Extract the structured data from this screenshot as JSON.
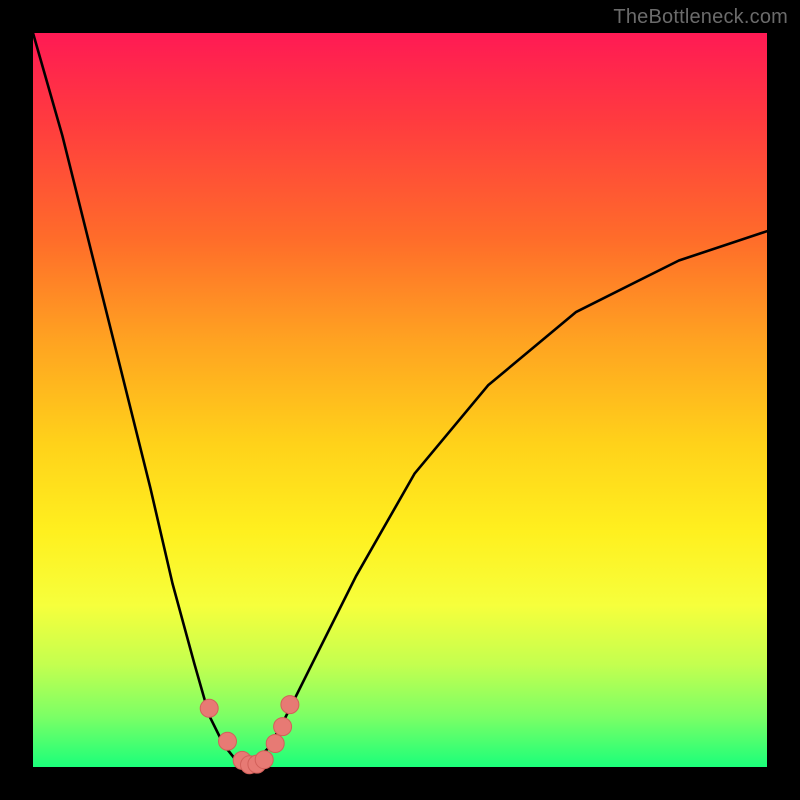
{
  "watermark": "TheBottleneck.com",
  "colors": {
    "frame": "#000000",
    "curve": "#000000",
    "marker_fill": "#e77a74",
    "marker_stroke": "#d2605a",
    "gradient_top": "#ff1a54",
    "gradient_bottom": "#1bff7a"
  },
  "chart_data": {
    "type": "line",
    "title": "",
    "xlabel": "",
    "ylabel": "",
    "xlim": [
      0,
      100
    ],
    "ylim": [
      0,
      100
    ],
    "notes": "y-axis inverted visually: 0 (best/green) at bottom, 100 (worst/red) at top. Curve represents bottleneck percentage vs. component scaling; minimum at x≈29 where bottleneck ≈0.",
    "series": [
      {
        "name": "bottleneck-curve",
        "x": [
          0,
          4,
          8,
          12,
          16,
          19,
          22,
          24,
          26,
          28,
          29,
          30,
          32,
          34,
          38,
          44,
          52,
          62,
          74,
          88,
          100
        ],
        "values": [
          100,
          86,
          70,
          54,
          38,
          25,
          14,
          7,
          3,
          0.5,
          0,
          0.5,
          2.5,
          6,
          14,
          26,
          40,
          52,
          62,
          69,
          73
        ]
      }
    ],
    "markers": {
      "name": "highlight-points",
      "x": [
        24,
        26.5,
        28.5,
        29.5,
        30.5,
        31.5,
        33,
        34,
        35
      ],
      "values": [
        8,
        3.5,
        0.9,
        0.3,
        0.4,
        1.0,
        3.2,
        5.5,
        8.5
      ],
      "radius_px": 9
    }
  }
}
